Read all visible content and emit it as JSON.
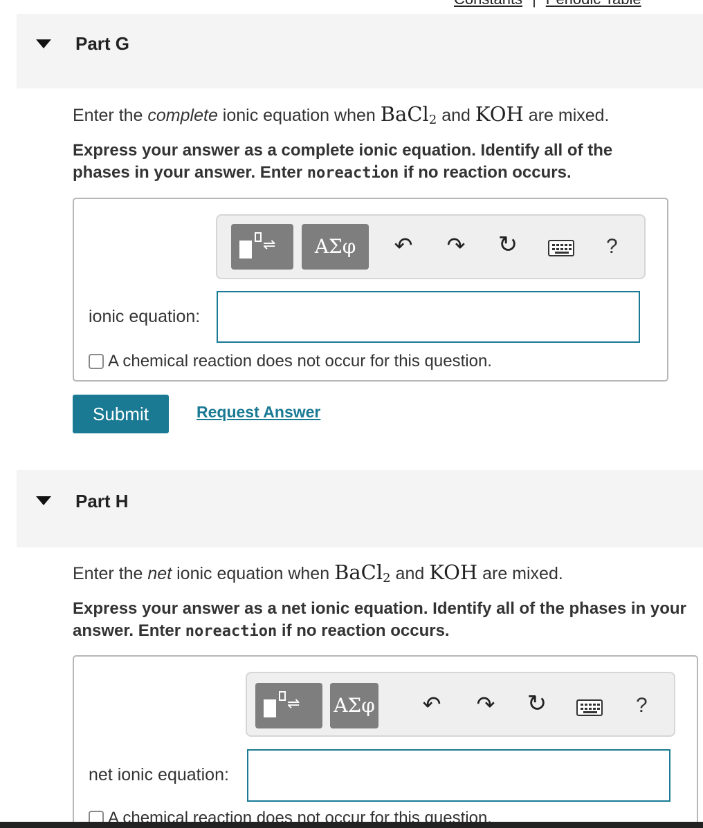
{
  "top_links": {
    "constants": "Constants",
    "separator": "|",
    "periodic_table": "Periodic Table"
  },
  "part_g": {
    "title": "Part G",
    "prompt_before": "Enter the ",
    "prompt_em": "complete",
    "prompt_mid": " ionic equation when ",
    "compound1_main": "BaCl",
    "compound1_sub": "2",
    "prompt_and": " and ",
    "compound2": "KOH",
    "prompt_after": " are mixed.",
    "instr_1": "Express your answer as a complete ionic equation. Identify all of the phases in your answer. Enter ",
    "instr_code": "noreaction",
    "instr_2": " if no reaction occurs.",
    "greek_label": "ΑΣφ",
    "help_label": "?",
    "field_label": "ionic equation:",
    "field_value": "",
    "checkbox_label": "A chemical reaction does not occur for this question.",
    "submit_label": "Submit",
    "request_label": "Request Answer"
  },
  "part_h": {
    "title": "Part H",
    "prompt_before": "Enter the ",
    "prompt_em": "net",
    "prompt_mid": " ionic equation when ",
    "compound1_main": "BaCl",
    "compound1_sub": "2",
    "prompt_and": " and ",
    "compound2": "KOH",
    "prompt_after": " are mixed.",
    "instr_1": "Express your answer as a net ionic equation. Identify all of the phases in your answer. Enter ",
    "instr_code": "noreaction",
    "instr_2": " if no reaction occurs.",
    "greek_label": "ΑΣφ",
    "help_label": "?",
    "field_label": "net ionic equation:",
    "field_value": "",
    "checkbox_label": "A chemical reaction does not occur for this question."
  },
  "icons": {
    "undo": "undo-icon",
    "redo": "redo-icon",
    "reset": "reset-icon",
    "keyboard": "keyboard-icon",
    "collapse": "triangle-down-icon"
  },
  "colors": {
    "accent": "#1a7a94",
    "header_bg": "#f4f4f4",
    "toolbar_btn": "#7e7e7e"
  }
}
